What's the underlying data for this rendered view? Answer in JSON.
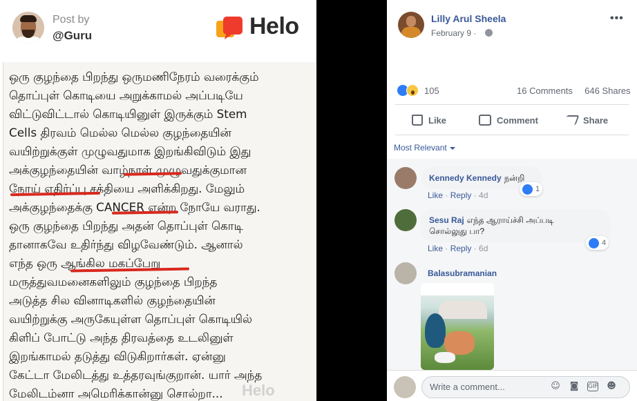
{
  "helo_post": {
    "post_by_label": "Post by",
    "handle": "@Guru",
    "brand": "Helo",
    "watermark": "Helo",
    "lines": [
      "ஒரு குழந்தை பிறந்து ஒருமணிநேரம் வரைக்கும்",
      "தொப்புள் கொடியை அறுக்காமல் அப்படியே",
      "விட்டுவிட்டால் கொடியினுள் இருக்கும் Stem",
      "Cells திரவம் மெல்ல மெல்ல குழந்தையின்",
      "வயிற்றுக்குள் முழுவதுமாக இறங்கிவிடும் இது",
      "அக்குழந்தையின் வாழ்நாள் முழுவதுக்குமான",
      "நோய் எதிர்ப்பு சக்தியை அளிக்கிறது. மேலும்",
      "அக்குழந்தைக்கு CANCER என்ற நோயே வராது.",
      "ஒரு குழந்தை பிறந்து அதன் தொப்புள் கொடி",
      "தானாகவே உதிர்ந்து விழவேண்டும். ஆனால்",
      "எந்த ஒரு ஆங்கில மகப்பேறு",
      "மருத்துவமனைகளிலும் குழந்தை பிறந்த",
      "அடுத்த சில வினாடிகளில் குழந்தையின்",
      "வயிற்றுக்கு அருகேயுள்ள தொப்புள் கொடியில்",
      "கிளிப் போட்டு அந்த திரவத்தை உடலினுள்",
      "இறங்காமல் தடுத்து விடுகிறார்கள். ஏன்னு",
      "கேட்டா மேலிடத்து உத்தரவுங்குறான். யார் அந்த",
      "மேலிடம்னா அமெரிக்கான்னு சொல்றா..."
    ]
  },
  "fb_post": {
    "author": "Lilly Arul Sheela",
    "date": "February 9 ·",
    "more_label": "•••",
    "reaction_count": "105",
    "comments_count": "16 Comments",
    "shares_count": "646 Shares",
    "actions": {
      "like": "Like",
      "comment": "Comment",
      "share": "Share"
    },
    "sort_label": "Most Relevant",
    "comments": [
      {
        "name": "Kennedy Kennedy",
        "text": "நன்றி",
        "like": "Like",
        "reply": "Reply",
        "time": "4d",
        "reactions": "1"
      },
      {
        "name": "Sesu Raj",
        "text": "எந்த ஆராய்ச்சி அப்படி",
        "text2": "சொல்லுது பா?",
        "like": "Like",
        "reply": "Reply",
        "time": "6d",
        "reactions": "4"
      },
      {
        "name": "Balasubramanian"
      }
    ],
    "write_placeholder": "Write a comment...",
    "input_icons": [
      "emoji-icon",
      "camera-icon",
      "gif-icon",
      "sticker-icon"
    ]
  },
  "colors": {
    "fb_blue": "#385898",
    "like_blue": "#2e7cf6",
    "underline_red": "#d8291e"
  }
}
